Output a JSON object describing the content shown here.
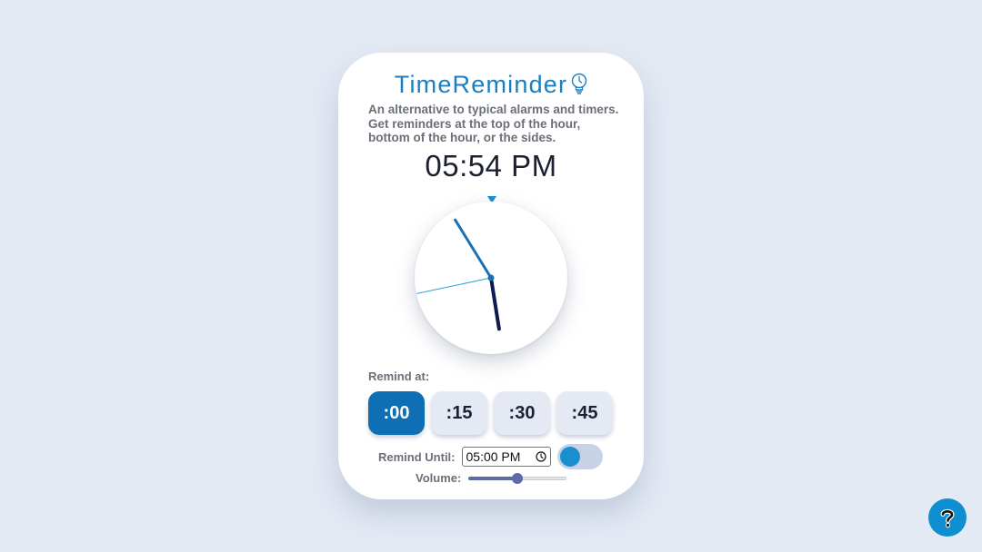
{
  "app": {
    "title": "TimeReminder",
    "description": "An alternative to typical alarms and timers. Get reminders at the top of the hour, bottom of the hour, or the sides."
  },
  "clock": {
    "digital_time": "05:54 PM",
    "hour": 5,
    "minute": 54,
    "second": 43
  },
  "remind": {
    "label": "Remind at:",
    "options": [
      ":00",
      ":15",
      ":30",
      ":45"
    ],
    "selected": ":00"
  },
  "until": {
    "label": "Remind Until:",
    "value": "05:00 PM",
    "toggle_on": true
  },
  "volume": {
    "label": "Volume:",
    "level": 0.5
  },
  "help": {
    "icon": "question-mark-icon"
  },
  "colors": {
    "accent": "#1a7fc0",
    "button_active": "#0f6fb4",
    "button_inactive": "#e4e9f3",
    "background": "#e4eaf4",
    "hour_hand": "#0d1b4d",
    "minute_hand": "#1e6fb0",
    "second_hand": "#29a3d9",
    "help_button": "#0f8fd0"
  }
}
